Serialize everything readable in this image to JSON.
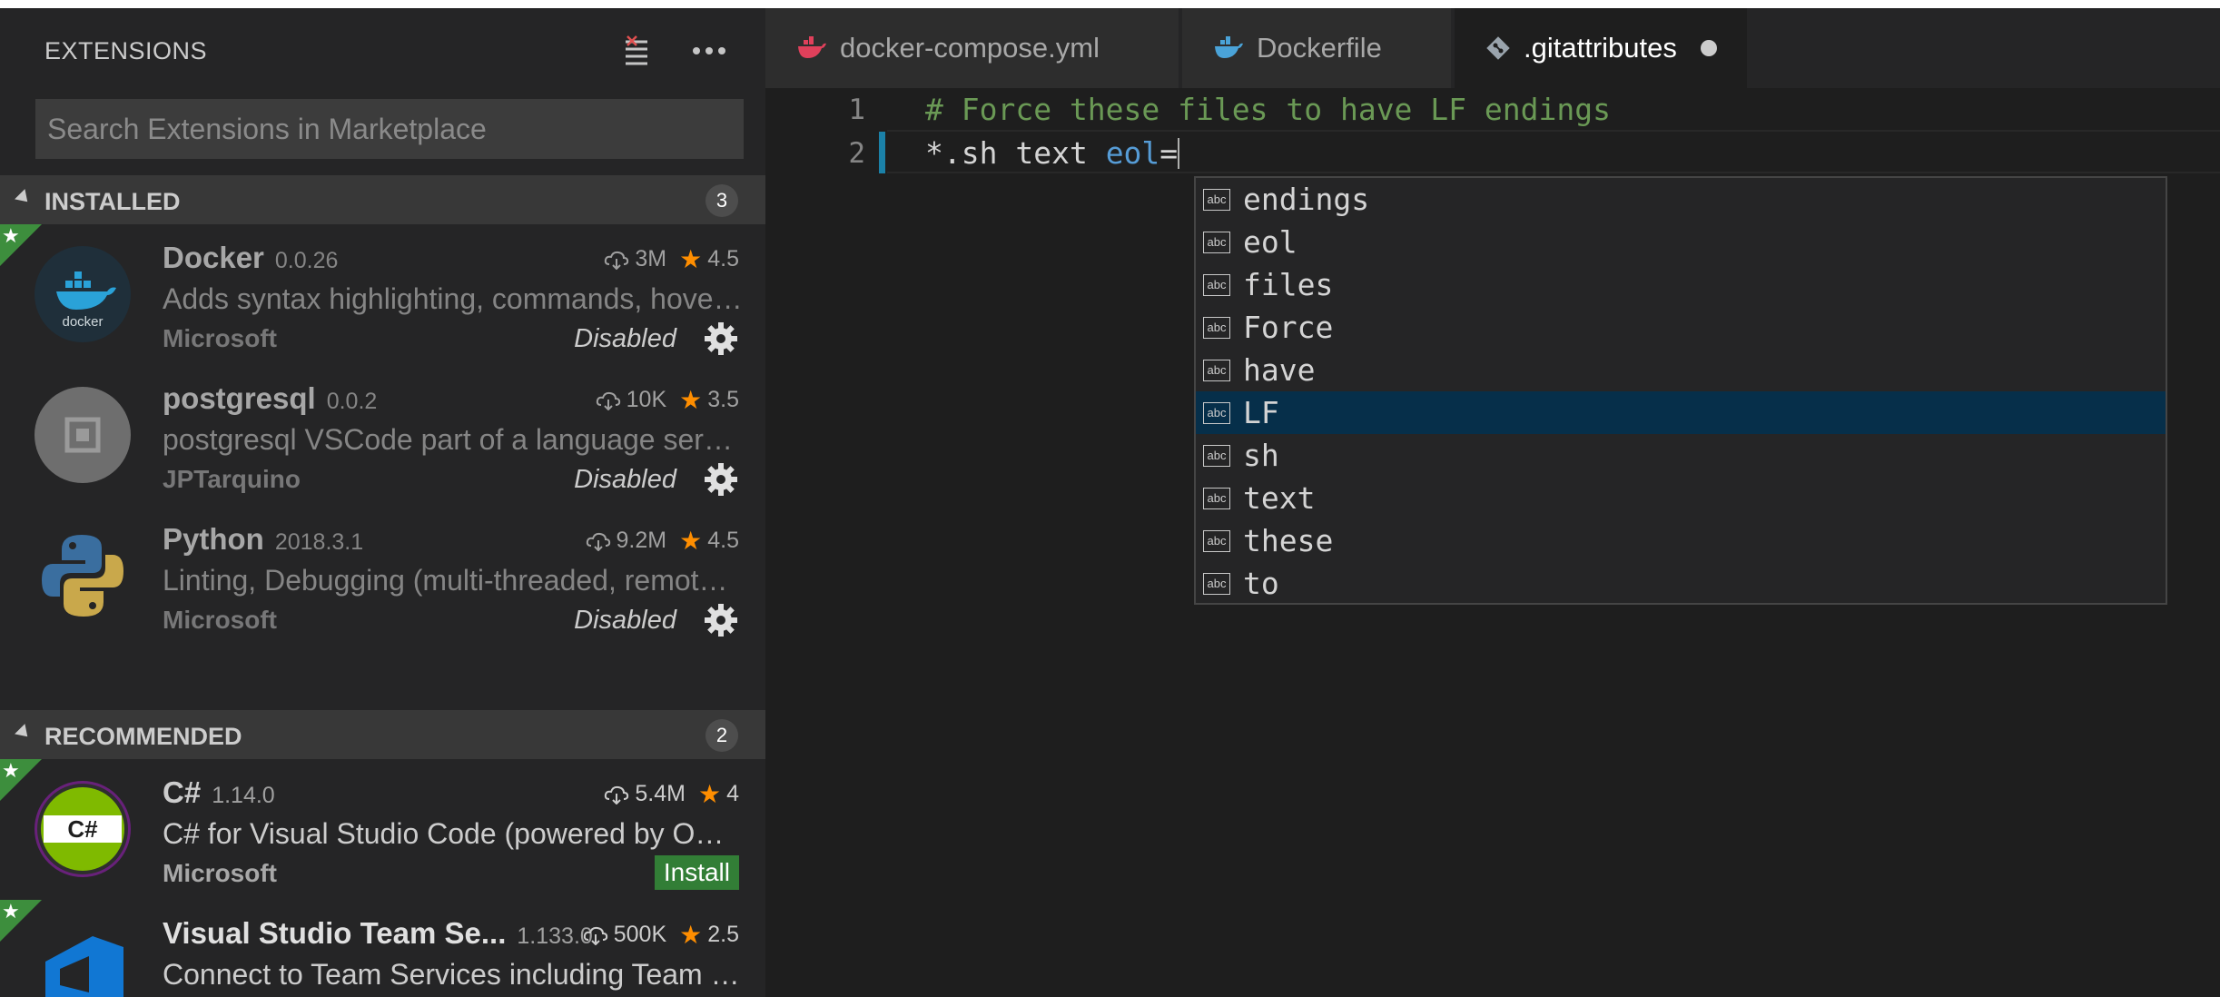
{
  "sidebar": {
    "title": "EXTENSIONS",
    "search_placeholder": "Search Extensions in Marketplace",
    "installed": {
      "label": "INSTALLED",
      "count": "3",
      "items": [
        {
          "name": "Docker",
          "version": "0.0.26",
          "downloads": "3M",
          "rating": "4.5",
          "description": "Adds syntax highlighting, commands, hover tips, and linting for Dockerfile and docker-compose files.",
          "publisher": "Microsoft",
          "status": "Disabled"
        },
        {
          "name": "postgresql",
          "version": "0.0.2",
          "downloads": "10K",
          "rating": "3.5",
          "description": "postgresql VSCode part of a language server",
          "publisher": "JPTarquino",
          "status": "Disabled"
        },
        {
          "name": "Python",
          "version": "2018.3.1",
          "downloads": "9.2M",
          "rating": "4.5",
          "description": "Linting, Debugging (multi-threaded, remote), Intellisense, code formatting",
          "publisher": "Microsoft",
          "status": "Disabled"
        }
      ]
    },
    "recommended": {
      "label": "RECOMMENDED",
      "count": "2",
      "items": [
        {
          "name": "C#",
          "version": "1.14.0",
          "downloads": "5.4M",
          "rating": "4",
          "description": "C# for Visual Studio Code (powered by OmniSharp).",
          "publisher": "Microsoft",
          "action": "Install"
        },
        {
          "name": "Visual Studio Team Se...",
          "version": "1.133.0",
          "downloads": "500K",
          "rating": "2.5",
          "description": "Connect to Team Services including Team Foundation Version Control"
        }
      ]
    },
    "star_glyph": "★"
  },
  "tabs": [
    {
      "label": "docker-compose.yml",
      "icon": "docker-whale-icon",
      "icon_color": "#e0405b"
    },
    {
      "label": "Dockerfile",
      "icon": "docker-whale-icon",
      "icon_color": "#4aa3d8"
    },
    {
      "label": ".gitattributes",
      "icon": "git-icon",
      "icon_color": "#9aa4ad",
      "dirty": true
    }
  ],
  "editor": {
    "lines": [
      {
        "number": "1",
        "comment": "# Force these files to have LF endings"
      },
      {
        "number": "2",
        "text_plain": "*.sh text ",
        "text_keyword": "eol",
        "text_rest": "="
      }
    ],
    "suggestions": [
      "endings",
      "eol",
      "files",
      "Force",
      "have",
      "LF",
      "sh",
      "text",
      "these",
      "to"
    ],
    "selected_suggestion": "LF",
    "suggestion_icon_label": "abc"
  },
  "colors": {
    "accent_selected": "#062f4a",
    "install_button": "#327e36",
    "comment": "#6a9955",
    "keyword": "#569cd6",
    "star": "#ff8e00"
  }
}
